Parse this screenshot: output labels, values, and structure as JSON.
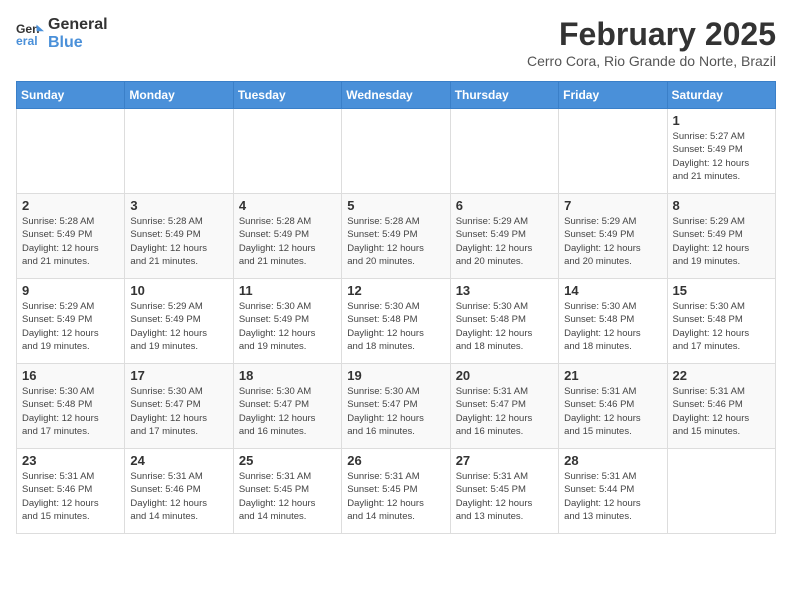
{
  "header": {
    "logo_line1": "General",
    "logo_line2": "Blue",
    "month_title": "February 2025",
    "location": "Cerro Cora, Rio Grande do Norte, Brazil"
  },
  "weekdays": [
    "Sunday",
    "Monday",
    "Tuesday",
    "Wednesday",
    "Thursday",
    "Friday",
    "Saturday"
  ],
  "weeks": [
    [
      {
        "day": "",
        "info": ""
      },
      {
        "day": "",
        "info": ""
      },
      {
        "day": "",
        "info": ""
      },
      {
        "day": "",
        "info": ""
      },
      {
        "day": "",
        "info": ""
      },
      {
        "day": "",
        "info": ""
      },
      {
        "day": "1",
        "info": "Sunrise: 5:27 AM\nSunset: 5:49 PM\nDaylight: 12 hours\nand 21 minutes."
      }
    ],
    [
      {
        "day": "2",
        "info": "Sunrise: 5:28 AM\nSunset: 5:49 PM\nDaylight: 12 hours\nand 21 minutes."
      },
      {
        "day": "3",
        "info": "Sunrise: 5:28 AM\nSunset: 5:49 PM\nDaylight: 12 hours\nand 21 minutes."
      },
      {
        "day": "4",
        "info": "Sunrise: 5:28 AM\nSunset: 5:49 PM\nDaylight: 12 hours\nand 21 minutes."
      },
      {
        "day": "5",
        "info": "Sunrise: 5:28 AM\nSunset: 5:49 PM\nDaylight: 12 hours\nand 20 minutes."
      },
      {
        "day": "6",
        "info": "Sunrise: 5:29 AM\nSunset: 5:49 PM\nDaylight: 12 hours\nand 20 minutes."
      },
      {
        "day": "7",
        "info": "Sunrise: 5:29 AM\nSunset: 5:49 PM\nDaylight: 12 hours\nand 20 minutes."
      },
      {
        "day": "8",
        "info": "Sunrise: 5:29 AM\nSunset: 5:49 PM\nDaylight: 12 hours\nand 19 minutes."
      }
    ],
    [
      {
        "day": "9",
        "info": "Sunrise: 5:29 AM\nSunset: 5:49 PM\nDaylight: 12 hours\nand 19 minutes."
      },
      {
        "day": "10",
        "info": "Sunrise: 5:29 AM\nSunset: 5:49 PM\nDaylight: 12 hours\nand 19 minutes."
      },
      {
        "day": "11",
        "info": "Sunrise: 5:30 AM\nSunset: 5:49 PM\nDaylight: 12 hours\nand 19 minutes."
      },
      {
        "day": "12",
        "info": "Sunrise: 5:30 AM\nSunset: 5:48 PM\nDaylight: 12 hours\nand 18 minutes."
      },
      {
        "day": "13",
        "info": "Sunrise: 5:30 AM\nSunset: 5:48 PM\nDaylight: 12 hours\nand 18 minutes."
      },
      {
        "day": "14",
        "info": "Sunrise: 5:30 AM\nSunset: 5:48 PM\nDaylight: 12 hours\nand 18 minutes."
      },
      {
        "day": "15",
        "info": "Sunrise: 5:30 AM\nSunset: 5:48 PM\nDaylight: 12 hours\nand 17 minutes."
      }
    ],
    [
      {
        "day": "16",
        "info": "Sunrise: 5:30 AM\nSunset: 5:48 PM\nDaylight: 12 hours\nand 17 minutes."
      },
      {
        "day": "17",
        "info": "Sunrise: 5:30 AM\nSunset: 5:47 PM\nDaylight: 12 hours\nand 17 minutes."
      },
      {
        "day": "18",
        "info": "Sunrise: 5:30 AM\nSunset: 5:47 PM\nDaylight: 12 hours\nand 16 minutes."
      },
      {
        "day": "19",
        "info": "Sunrise: 5:30 AM\nSunset: 5:47 PM\nDaylight: 12 hours\nand 16 minutes."
      },
      {
        "day": "20",
        "info": "Sunrise: 5:31 AM\nSunset: 5:47 PM\nDaylight: 12 hours\nand 16 minutes."
      },
      {
        "day": "21",
        "info": "Sunrise: 5:31 AM\nSunset: 5:46 PM\nDaylight: 12 hours\nand 15 minutes."
      },
      {
        "day": "22",
        "info": "Sunrise: 5:31 AM\nSunset: 5:46 PM\nDaylight: 12 hours\nand 15 minutes."
      }
    ],
    [
      {
        "day": "23",
        "info": "Sunrise: 5:31 AM\nSunset: 5:46 PM\nDaylight: 12 hours\nand 15 minutes."
      },
      {
        "day": "24",
        "info": "Sunrise: 5:31 AM\nSunset: 5:46 PM\nDaylight: 12 hours\nand 14 minutes."
      },
      {
        "day": "25",
        "info": "Sunrise: 5:31 AM\nSunset: 5:45 PM\nDaylight: 12 hours\nand 14 minutes."
      },
      {
        "day": "26",
        "info": "Sunrise: 5:31 AM\nSunset: 5:45 PM\nDaylight: 12 hours\nand 14 minutes."
      },
      {
        "day": "27",
        "info": "Sunrise: 5:31 AM\nSunset: 5:45 PM\nDaylight: 12 hours\nand 13 minutes."
      },
      {
        "day": "28",
        "info": "Sunrise: 5:31 AM\nSunset: 5:44 PM\nDaylight: 12 hours\nand 13 minutes."
      },
      {
        "day": "",
        "info": ""
      }
    ]
  ]
}
